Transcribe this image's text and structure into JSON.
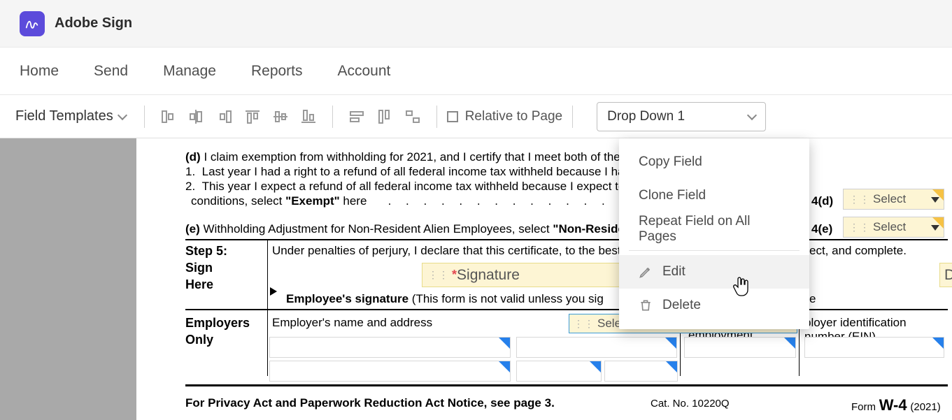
{
  "app": {
    "title": "Adobe Sign"
  },
  "nav": {
    "items": [
      "Home",
      "Send",
      "Manage",
      "Reports",
      "Account"
    ]
  },
  "toolbar": {
    "field_templates": "Field Templates",
    "relative_to_page": "Relative to Page",
    "dropdown_selected": "Drop Down 1"
  },
  "context_menu": {
    "copy": "Copy Field",
    "clone": "Clone Field",
    "repeat": "Repeat Field on All Pages",
    "edit": "Edit",
    "delete": "Delete"
  },
  "doc": {
    "d_label": "(d)",
    "d_text": "I claim exemption from withholding for 2021, and I certify that I meet both of the foll",
    "d_line1": "1.  Last year I had a right to a refund of all federal income tax withheld because I had n",
    "d_line2": "2.  This year I expect a refund of all federal income tax withheld because I expect to ha",
    "d_line3_a": "conditions, select ",
    "d_line3_b": "\"Exempt\"",
    "d_line3_c": " here",
    "e_label": "(e)",
    "e_text": "Withholding Adjustment for Non-Resident Alien Employees, select ",
    "e_bold": "\"Non-Resident",
    "step5": "Step 5:",
    "sign": "Sign",
    "here": "Here",
    "perjury": "Under penalties of perjury, I declare that this certificate, to the best of",
    "perjury_tail": "ect, and complete.",
    "emp_sig_a": "Employee's signature ",
    "emp_sig_b": "(This form is not valid unless you sig",
    "employers": "Employers",
    "only": "Only",
    "emp_name": "Employer's name and address",
    "employment": "employment",
    "ein1": "ployer identification",
    "ein2": "number (EIN)",
    "privacy": "For Privacy Act and Paperwork Reduction Act Notice, see page 3.",
    "catno": "Cat. No. 10220Q",
    "form_label": "Form",
    "form_w4": "W-4",
    "form_year": "(2021)",
    "label_4d": "4(d)",
    "label_4e": "4(e)",
    "select_placeholder": "Select",
    "select_ellipsis": "Select...",
    "signature_placeholder": "Signature",
    "date_placeholder": "Date",
    "e_trail": "e",
    "asterisk": "*"
  }
}
